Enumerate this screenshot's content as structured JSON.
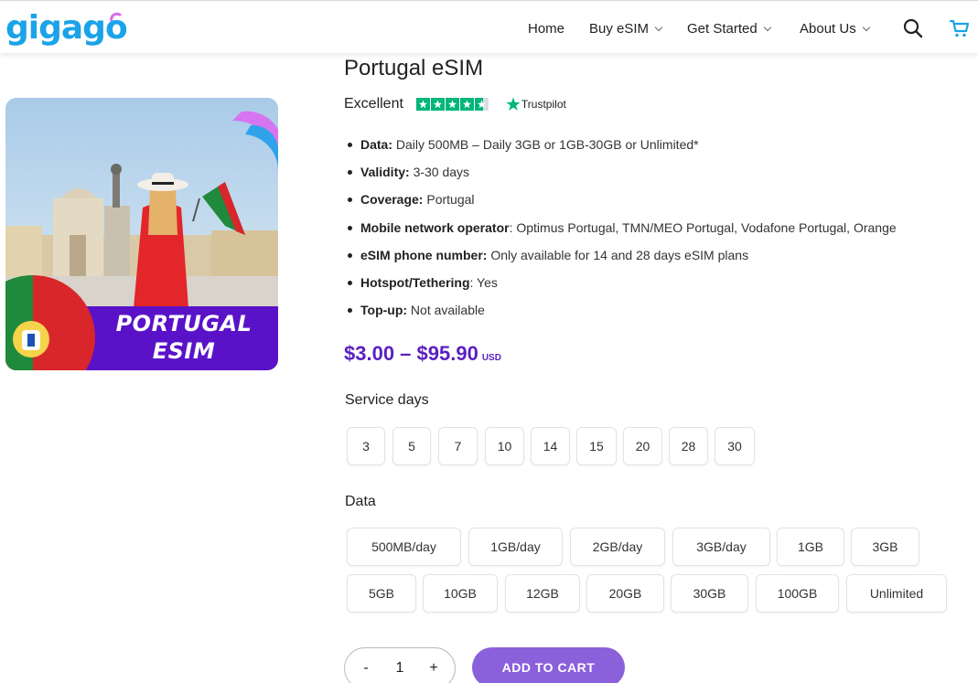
{
  "header": {
    "logo": "gigago",
    "nav": [
      {
        "label": "Home",
        "dropdown": false
      },
      {
        "label": "Buy eSIM",
        "dropdown": true
      },
      {
        "label": "Get Started",
        "dropdown": true
      },
      {
        "label": "About Us",
        "dropdown": true
      }
    ],
    "icons": [
      "search-icon",
      "cart-icon"
    ]
  },
  "product": {
    "image_text_line1": "PORTUGAL",
    "image_text_line2": "ESIM",
    "title": "Portugal eSIM",
    "rating_label": "Excellent",
    "trustpilot_label": "Trustpilot",
    "specs": [
      {
        "label": "Data:",
        "value": " Daily 500MB – Daily 3GB or 1GB-30GB or Unlimited*"
      },
      {
        "label": "Validity:",
        "value": " 3-30 days"
      },
      {
        "label": "Coverage:",
        "value": " Portugal"
      },
      {
        "label": "Mobile network operator",
        "value": ": Optimus Portugal, TMN/MEO Portugal, Vodafone Portugal, Orange"
      },
      {
        "label": "eSIM phone number:",
        "value": " Only available for 14 and 28 days eSIM plans"
      },
      {
        "label": "Hotspot/Tethering",
        "value": ": Yes"
      },
      {
        "label": "Top-up:",
        "value": " Not available"
      }
    ],
    "price": "$3.00 – $95.90",
    "currency": "USD"
  },
  "service_days": {
    "label": "Service days",
    "options": [
      "3",
      "5",
      "7",
      "10",
      "14",
      "15",
      "20",
      "28",
      "30"
    ]
  },
  "data_options": {
    "label": "Data",
    "row1": [
      "500MB/day",
      "1GB/day",
      "2GB/day",
      "3GB/day",
      "1GB",
      "3GB"
    ],
    "row2": [
      "5GB",
      "10GB",
      "12GB",
      "20GB",
      "30GB",
      "100GB",
      "Unlimited"
    ]
  },
  "cart": {
    "minus": "-",
    "quantity": "1",
    "plus": "+",
    "add_label": "ADD TO CART"
  },
  "colors": {
    "brand_blue": "#1aa3e8",
    "price_purple": "#5b1fc2",
    "button_purple": "#8b60db",
    "trustpilot_green": "#00b67a"
  }
}
